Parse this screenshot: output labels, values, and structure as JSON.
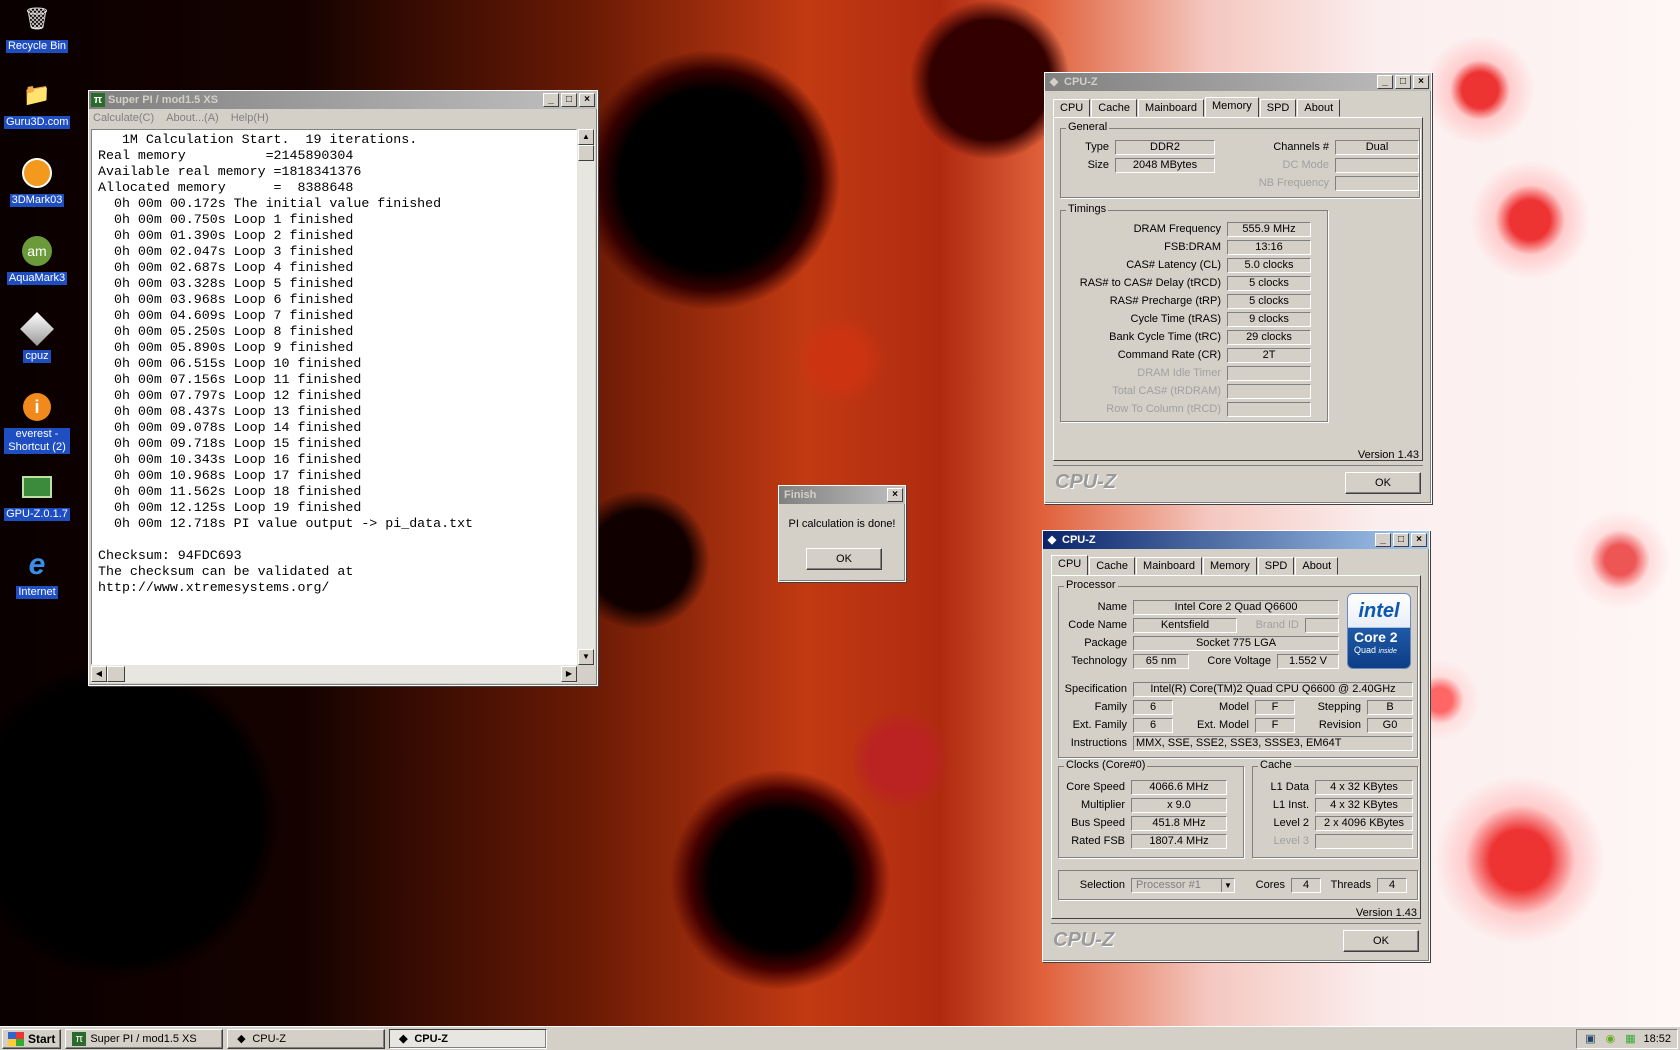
{
  "desktop": {
    "icons": [
      {
        "label": "Recycle Bin",
        "icon": "recycle-bin-icon"
      },
      {
        "label": "Guru3D.com",
        "icon": "folder-icon"
      },
      {
        "label": "3DMark03",
        "icon": "3dmark-icon"
      },
      {
        "label": "AquaMark3",
        "icon": "aquamark-icon"
      },
      {
        "label": "cpuz",
        "icon": "cpuz-icon"
      },
      {
        "label": "everest - Shortcut (2)",
        "icon": "everest-icon"
      },
      {
        "label": "GPU-Z.0.1.7",
        "icon": "gpuz-icon"
      },
      {
        "label": "Internet",
        "icon": "internet-explorer-icon"
      }
    ]
  },
  "superpi": {
    "title": "Super PI / mod1.5 XS",
    "menu": [
      "Calculate(C)",
      "About...(A)",
      "Help(H)"
    ],
    "output": "   1M Calculation Start.  19 iterations.\nReal memory          =2145890304\nAvailable real memory =1818341376\nAllocated memory      =  8388648\n  0h 00m 00.172s The initial value finished\n  0h 00m 00.750s Loop 1 finished\n  0h 00m 01.390s Loop 2 finished\n  0h 00m 02.047s Loop 3 finished\n  0h 00m 02.687s Loop 4 finished\n  0h 00m 03.328s Loop 5 finished\n  0h 00m 03.968s Loop 6 finished\n  0h 00m 04.609s Loop 7 finished\n  0h 00m 05.250s Loop 8 finished\n  0h 00m 05.890s Loop 9 finished\n  0h 00m 06.515s Loop 10 finished\n  0h 00m 07.156s Loop 11 finished\n  0h 00m 07.797s Loop 12 finished\n  0h 00m 08.437s Loop 13 finished\n  0h 00m 09.078s Loop 14 finished\n  0h 00m 09.718s Loop 15 finished\n  0h 00m 10.343s Loop 16 finished\n  0h 00m 10.968s Loop 17 finished\n  0h 00m 11.562s Loop 18 finished\n  0h 00m 12.125s Loop 19 finished\n  0h 00m 12.718s PI value output -> pi_data.txt\n\nChecksum: 94FDC693\nThe checksum can be validated at\nhttp://www.xtremesystems.org/"
  },
  "finish_dialog": {
    "title": "Finish",
    "message": "PI calculation is done!",
    "ok": "OK"
  },
  "cpuz_memory": {
    "title": "CPU-Z",
    "tabs": [
      "CPU",
      "Cache",
      "Mainboard",
      "Memory",
      "SPD",
      "About"
    ],
    "selected_tab": "Memory",
    "general_title": "General",
    "type_label": "Type",
    "type": "DDR2",
    "size_label": "Size",
    "size": "2048 MBytes",
    "channels_label": "Channels #",
    "channels": "Dual",
    "dcmode_label": "DC Mode",
    "dcmode": "",
    "nbfreq_label": "NB Frequency",
    "nbfreq": "",
    "timings_title": "Timings",
    "timings": [
      {
        "label": "DRAM Frequency",
        "value": "555.9 MHz",
        "enabled": true
      },
      {
        "label": "FSB:DRAM",
        "value": "13:16",
        "enabled": true
      },
      {
        "label": "CAS# Latency (CL)",
        "value": "5.0 clocks",
        "enabled": true
      },
      {
        "label": "RAS# to CAS# Delay (tRCD)",
        "value": "5 clocks",
        "enabled": true
      },
      {
        "label": "RAS# Precharge (tRP)",
        "value": "5 clocks",
        "enabled": true
      },
      {
        "label": "Cycle Time (tRAS)",
        "value": "9 clocks",
        "enabled": true
      },
      {
        "label": "Bank Cycle Time (tRC)",
        "value": "29 clocks",
        "enabled": true
      },
      {
        "label": "Command Rate (CR)",
        "value": "2T",
        "enabled": true
      },
      {
        "label": "DRAM Idle Timer",
        "value": "",
        "enabled": false
      },
      {
        "label": "Total CAS# (tRDRAM)",
        "value": "",
        "enabled": false
      },
      {
        "label": "Row To Column (tRCD)",
        "value": "",
        "enabled": false
      }
    ],
    "version": "Version 1.43",
    "logo": "CPU-Z",
    "ok": "OK"
  },
  "cpuz_cpu": {
    "title": "CPU-Z",
    "tabs": [
      "CPU",
      "Cache",
      "Mainboard",
      "Memory",
      "SPD",
      "About"
    ],
    "selected_tab": "CPU",
    "processor_title": "Processor",
    "name_label": "Name",
    "name": "Intel Core 2 Quad Q6600",
    "codename_label": "Code Name",
    "codename": "Kentsfield",
    "brandid_label": "Brand ID",
    "brandid": "",
    "package_label": "Package",
    "package": "Socket 775 LGA",
    "technology_label": "Technology",
    "technology": "65 nm",
    "voltage_label": "Core Voltage",
    "voltage": "1.552 V",
    "spec_label": "Specification",
    "spec": "Intel(R) Core(TM)2 Quad CPU    Q6600  @ 2.40GHz",
    "family_label": "Family",
    "family": "6",
    "model_label": "Model",
    "model": "F",
    "stepping_label": "Stepping",
    "stepping": "B",
    "extfamily_label": "Ext. Family",
    "extfamily": "6",
    "extmodel_label": "Ext. Model",
    "extmodel": "F",
    "revision_label": "Revision",
    "revision": "G0",
    "instructions_label": "Instructions",
    "instructions": "MMX, SSE, SSE2, SSE3, SSSE3, EM64T",
    "intel_logo": {
      "brand": "intel",
      "line": "Core 2",
      "sub": "Quad",
      "tag": "inside"
    },
    "clocks_title": "Clocks (Core#0)",
    "corespeed_label": "Core Speed",
    "corespeed": "4066.6 MHz",
    "multiplier_label": "Multiplier",
    "multiplier": "x 9.0",
    "busspeed_label": "Bus Speed",
    "busspeed": "451.8 MHz",
    "ratedfsb_label": "Rated FSB",
    "ratedfsb": "1807.4 MHz",
    "cache_title": "Cache",
    "l1data_label": "L1 Data",
    "l1data": "4 x 32 KBytes",
    "l1inst_label": "L1 Inst.",
    "l1inst": "4 x 32 KBytes",
    "level2_label": "Level 2",
    "level2": "2 x 4096 KBytes",
    "level3_label": "Level 3",
    "level3": "",
    "selection_label": "Selection",
    "selection": "Processor #1",
    "cores_label": "Cores",
    "cores": "4",
    "threads_label": "Threads",
    "threads": "4",
    "version": "Version 1.43",
    "logo": "CPU-Z",
    "ok": "OK"
  },
  "taskbar": {
    "start": "Start",
    "tasks": [
      "Super PI / mod1.5 XS",
      "CPU-Z",
      "CPU-Z"
    ],
    "clock": "18:52"
  }
}
